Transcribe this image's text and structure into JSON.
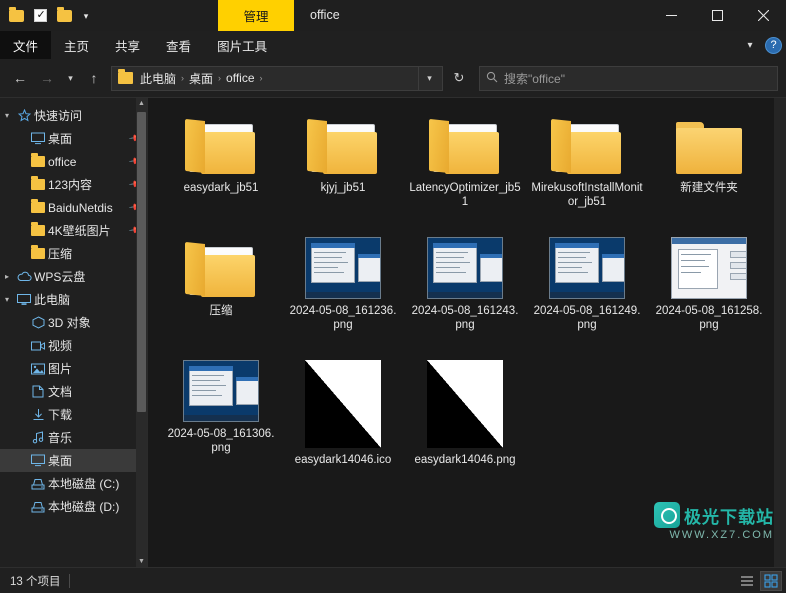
{
  "titlebar": {
    "quick_access": {
      "folder_icon": "folder-icon",
      "properties_icon": "properties-checkbox-icon",
      "new_folder_icon": "new-folder-icon",
      "dropdown_icon": "chevron-down-icon"
    },
    "context_tab": "管理",
    "window_title": "office",
    "minimize": "─",
    "maximize": "□",
    "close": "✕"
  },
  "ribbon": {
    "tabs": [
      {
        "label": "文件",
        "active": true
      },
      {
        "label": "主页",
        "active": false
      },
      {
        "label": "共享",
        "active": false
      },
      {
        "label": "查看",
        "active": false
      },
      {
        "label": "图片工具",
        "active": false
      }
    ],
    "collapse_icon": "chevron-down-icon",
    "help_label": "?"
  },
  "address_bar": {
    "back_icon": "←",
    "forward_icon": "→",
    "recent_icon": "⌄",
    "up_icon": "↑",
    "breadcrumb": [
      "此电脑",
      "桌面",
      "office"
    ],
    "breadcrumb_sep": "›",
    "dropdown_icon": "chevron-down-icon",
    "refresh_icon": "↻",
    "search_icon": "search-icon",
    "search_placeholder": "搜索\"office\""
  },
  "sidebar": {
    "items": [
      {
        "label": "快速访问",
        "icon": "star-icon",
        "expander": "▾",
        "pinned": false,
        "indent": 0,
        "selected": false
      },
      {
        "label": "桌面",
        "icon": "desktop-icon",
        "expander": "",
        "pinned": true,
        "indent": 1,
        "selected": false
      },
      {
        "label": "office",
        "icon": "folder-icon",
        "expander": "",
        "pinned": true,
        "indent": 1,
        "selected": false
      },
      {
        "label": "123内容",
        "icon": "folder-icon",
        "expander": "",
        "pinned": true,
        "indent": 1,
        "selected": false
      },
      {
        "label": "BaiduNetdis",
        "icon": "folder-icon",
        "expander": "",
        "pinned": true,
        "indent": 1,
        "selected": false
      },
      {
        "label": "4K壁纸图片",
        "icon": "folder-icon",
        "expander": "",
        "pinned": true,
        "indent": 1,
        "selected": false
      },
      {
        "label": "压缩",
        "icon": "folder-icon",
        "expander": "",
        "pinned": false,
        "indent": 1,
        "selected": false
      },
      {
        "label": "WPS云盘",
        "icon": "cloud-icon",
        "expander": "▸",
        "pinned": false,
        "indent": 0,
        "selected": false
      },
      {
        "label": "此电脑",
        "icon": "computer-icon",
        "expander": "▾",
        "pinned": false,
        "indent": 0,
        "selected": false
      },
      {
        "label": "3D 对象",
        "icon": "3d-object-icon",
        "expander": "",
        "pinned": false,
        "indent": 1,
        "selected": false
      },
      {
        "label": "视频",
        "icon": "video-icon",
        "expander": "",
        "pinned": false,
        "indent": 1,
        "selected": false
      },
      {
        "label": "图片",
        "icon": "pictures-icon",
        "expander": "",
        "pinned": false,
        "indent": 1,
        "selected": false
      },
      {
        "label": "文档",
        "icon": "documents-icon",
        "expander": "",
        "pinned": false,
        "indent": 1,
        "selected": false
      },
      {
        "label": "下载",
        "icon": "downloads-icon",
        "expander": "",
        "pinned": false,
        "indent": 1,
        "selected": false
      },
      {
        "label": "音乐",
        "icon": "music-icon",
        "expander": "",
        "pinned": false,
        "indent": 1,
        "selected": false
      },
      {
        "label": "桌面",
        "icon": "desktop-icon",
        "expander": "",
        "pinned": false,
        "indent": 1,
        "selected": true
      },
      {
        "label": "本地磁盘 (C:)",
        "icon": "drive-icon",
        "expander": "",
        "pinned": false,
        "indent": 1,
        "selected": false
      },
      {
        "label": "本地磁盘 (D:)",
        "icon": "drive-icon",
        "expander": "",
        "pinned": false,
        "indent": 1,
        "selected": false
      }
    ]
  },
  "files": [
    {
      "name": "easydark_jb51",
      "type": "folder-color-wheel"
    },
    {
      "name": "kjyj_jb51",
      "type": "folder-color-wheel"
    },
    {
      "name": "LatencyOptimizer_jb51",
      "type": "folder-color-wheel"
    },
    {
      "name": "MirekusoftInstallMonitor_jb51",
      "type": "folder-color-wheel"
    },
    {
      "name": "新建文件夹",
      "type": "folder-plain"
    },
    {
      "name": "压缩",
      "type": "folder-color-wheel"
    },
    {
      "name": "2024-05-08_161236.png",
      "type": "screenshot-blue"
    },
    {
      "name": "2024-05-08_161243.png",
      "type": "screenshot-blue"
    },
    {
      "name": "2024-05-08_161249.png",
      "type": "screenshot-blue"
    },
    {
      "name": "2024-05-08_161258.png",
      "type": "screenshot-white"
    },
    {
      "name": "2024-05-08_161306.png",
      "type": "screenshot-blue"
    },
    {
      "name": "easydark14046.ico",
      "type": "triangle"
    },
    {
      "name": "easydark14046.png",
      "type": "triangle"
    }
  ],
  "statusbar": {
    "item_count": "13 个项目",
    "list_view_icon": "list-view-icon",
    "tile_view_icon": "tile-view-icon"
  },
  "watermark": {
    "title": "极光下载站",
    "subtitle": "WWW.XZ7.COM"
  }
}
